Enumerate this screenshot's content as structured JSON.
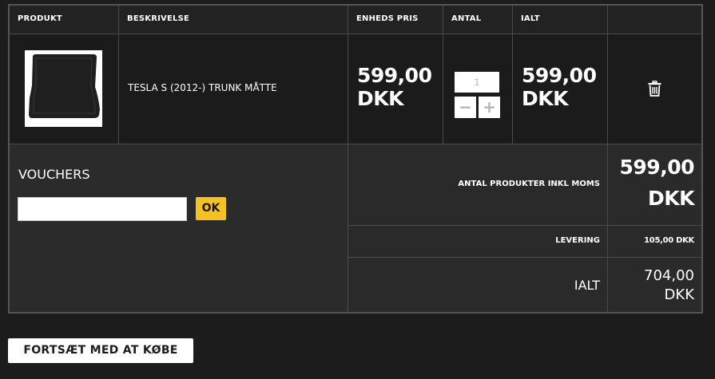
{
  "headers": {
    "product": "PRODUKT",
    "description": "BESKRIVELSE",
    "unit_price": "ENHEDS PRIS",
    "quantity": "ANTAL",
    "total": "IALT"
  },
  "item": {
    "name": "TESLA S (2012-) TRUNK MÅTTE",
    "unit_price_amount": "599,00",
    "unit_price_currency": "DKK",
    "quantity": "1",
    "total_amount": "599,00",
    "total_currency": "DKK",
    "minus_label": "−",
    "plus_label": "+"
  },
  "voucher": {
    "title": "VOUCHERS",
    "input_value": "",
    "button_label": "OK"
  },
  "summary": {
    "products_label": "ANTAL PRODUKTER INKL MOMS",
    "products_amount": "599,00",
    "products_currency": "DKK",
    "delivery_label": "LEVERING",
    "delivery_value": "105,00 DKK",
    "total_label": "IALT",
    "total_amount": "704,00",
    "total_currency": "DKK"
  },
  "continue_label": "FORTSÆT MED AT KØBE",
  "icons": {
    "delete": "trash-icon"
  },
  "colors": {
    "accent": "#f6c223",
    "background": "#1d1c1c"
  }
}
